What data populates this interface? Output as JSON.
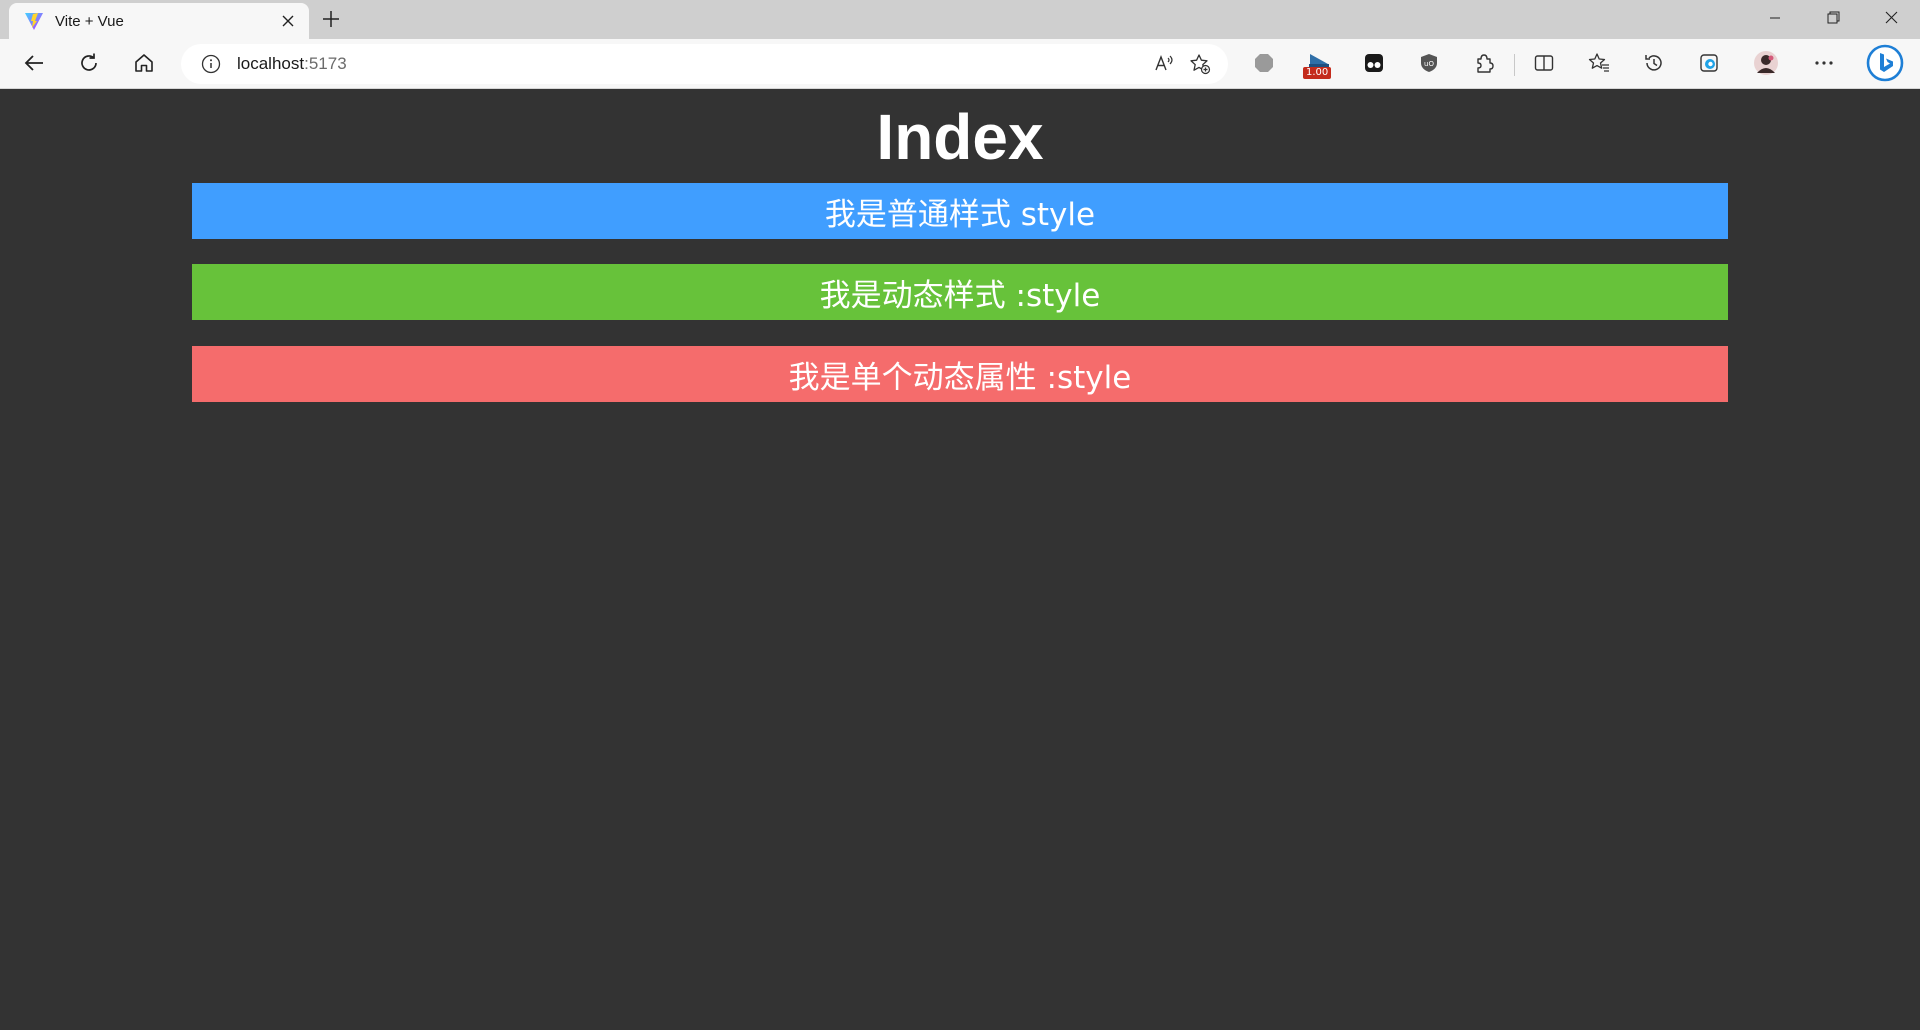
{
  "browser": {
    "tab": {
      "title": "Vite + Vue"
    },
    "address": {
      "host": "localhost",
      "port": ":5173"
    },
    "extension_badge": "1.00"
  },
  "page": {
    "title": "Index",
    "boxes": [
      {
        "text": "我是普通样式 style",
        "color": "#409eff"
      },
      {
        "text": "我是动态样式 :style",
        "color": "#67c23a"
      },
      {
        "text": "我是单个动态属性 :style",
        "color": "#f56c6c"
      }
    ]
  },
  "icons": {
    "tab": [
      "vite-logo-icon",
      "close-icon",
      "plus-icon"
    ],
    "window": [
      "minimize-icon",
      "restore-icon",
      "close-window-icon"
    ],
    "toolbar": [
      "back-arrow-icon",
      "refresh-icon",
      "home-icon",
      "info-icon",
      "read-aloud-icon",
      "add-favorite-icon",
      "extension-icon",
      "split-screen-icon",
      "favorites-icon",
      "history-icon",
      "edge-collections-icon",
      "profile-avatar-icon",
      "more-icon",
      "bing-icon"
    ]
  }
}
